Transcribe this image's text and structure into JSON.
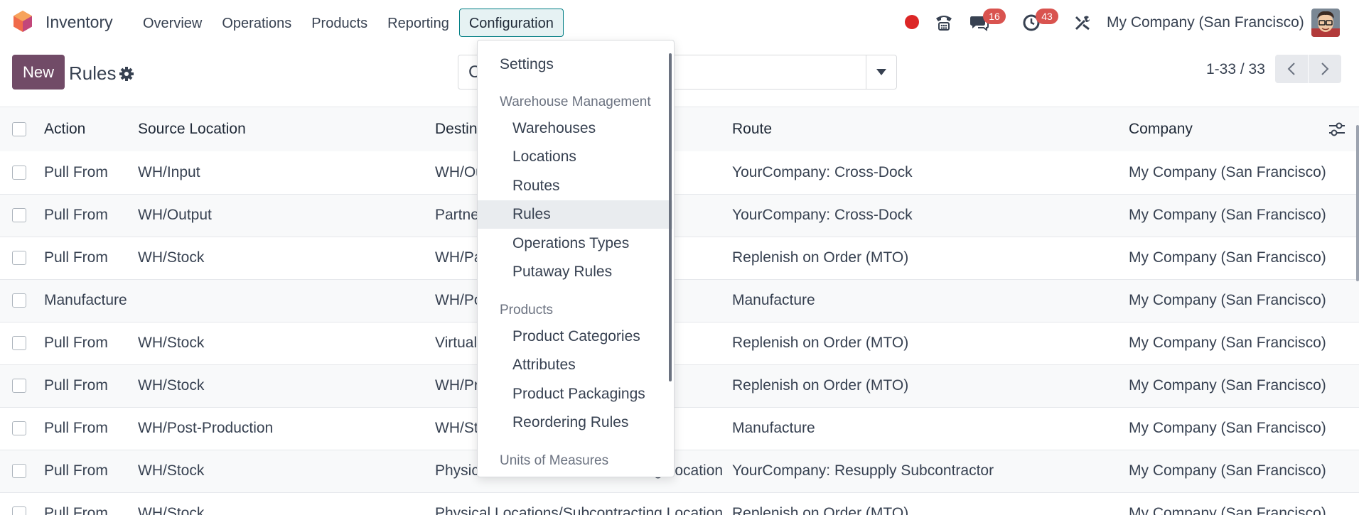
{
  "navbar": {
    "app_name": "Inventory",
    "menu": [
      "Overview",
      "Operations",
      "Products",
      "Reporting",
      "Configuration"
    ],
    "open_menu": "Configuration",
    "discuss_count": "16",
    "activity_count": "43",
    "company": "My Company (San Francisco)"
  },
  "control_panel": {
    "new_label": "New",
    "title": "Rules",
    "search_value": "",
    "pager": "1-33 / 33"
  },
  "table": {
    "headers": [
      "Action",
      "Source Location",
      "Destination Location",
      "Route",
      "Company"
    ],
    "rows": [
      [
        "Pull From",
        "WH/Input",
        "WH/Output",
        "YourCompany: Cross-Dock",
        "My Company (San Francisco)"
      ],
      [
        "Pull From",
        "WH/Output",
        "Partners/Customers",
        "YourCompany: Cross-Dock",
        "My Company (San Francisco)"
      ],
      [
        "Pull From",
        "WH/Stock",
        "WH/Packing Zone",
        "Replenish on Order (MTO)",
        "My Company (San Francisco)"
      ],
      [
        "Manufacture",
        "",
        "WH/Post-Production",
        "Manufacture",
        "My Company (San Francisco)"
      ],
      [
        "Pull From",
        "WH/Stock",
        "Virtual Locations/Production",
        "Replenish on Order (MTO)",
        "My Company (San Francisco)"
      ],
      [
        "Pull From",
        "WH/Stock",
        "WH/Pre-Production",
        "Replenish on Order (MTO)",
        "My Company (San Francisco)"
      ],
      [
        "Pull From",
        "WH/Post-Production",
        "WH/Stock",
        "Manufacture",
        "My Company (San Francisco)"
      ],
      [
        "Pull From",
        "WH/Stock",
        "Physical Locations/Subcontracting Location",
        "YourCompany: Resupply Subcontractor",
        "My Company (San Francisco)"
      ],
      [
        "Pull From",
        "WH/Stock",
        "Physical Locations/Subcontracting Location",
        "Replenish on Order (MTO)",
        "My Company (San Francisco)"
      ]
    ]
  },
  "dropdown": {
    "settings": "Settings",
    "section_warehouse": "Warehouse Management",
    "warehouse_items": [
      "Warehouses",
      "Locations",
      "Routes",
      "Rules",
      "Operations Types",
      "Putaway Rules"
    ],
    "section_products": "Products",
    "product_items": [
      "Product Categories",
      "Attributes",
      "Product Packagings",
      "Reordering Rules"
    ],
    "section_uom": "Units of Measures",
    "active_item": "Rules"
  },
  "colors": {
    "brand": "#714b67",
    "accent": "#017e84",
    "badge": "#d9534f"
  }
}
